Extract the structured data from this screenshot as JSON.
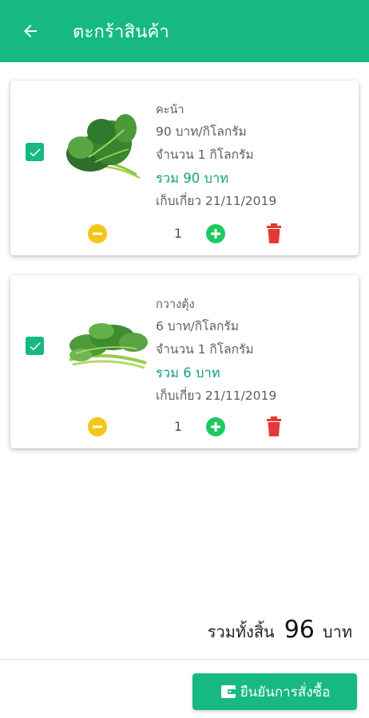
{
  "appbar": {
    "title": "ตะกร้าสินค้า",
    "back_icon": "arrow-left-icon",
    "color": "#16b981"
  },
  "cart_items": [
    {
      "name": "คะน้า",
      "price": "90 บาท/กิโลกรัม",
      "quantity_text": "จำนวน 1 กิโลกรัม",
      "total": "รวม 90 บาท",
      "harvest_date": "เก็บเกี่ยว 21/11/2019",
      "quantity": "1",
      "checked": true
    },
    {
      "name": "กวางตุ้ง",
      "price": "6 บาท/กิโลกรัม",
      "quantity_text": "จำนวน 1 กิโลกรัม",
      "total": "รวม 6 บาท",
      "harvest_date": "เก็บเกี่ยว 21/11/2019",
      "quantity": "1",
      "checked": true
    }
  ],
  "summary": {
    "label": "รวมทั้งสิ้น",
    "value": "96",
    "unit": "บาท"
  },
  "confirm_button": {
    "label": "ยืนยันการสั่งซื้อ",
    "icon": "wallet-icon"
  },
  "colors": {
    "accent": "#16b981",
    "minus": "#f5c518",
    "plus": "#1ec95f",
    "delete": "#e53935",
    "total_text": "#16a085"
  }
}
